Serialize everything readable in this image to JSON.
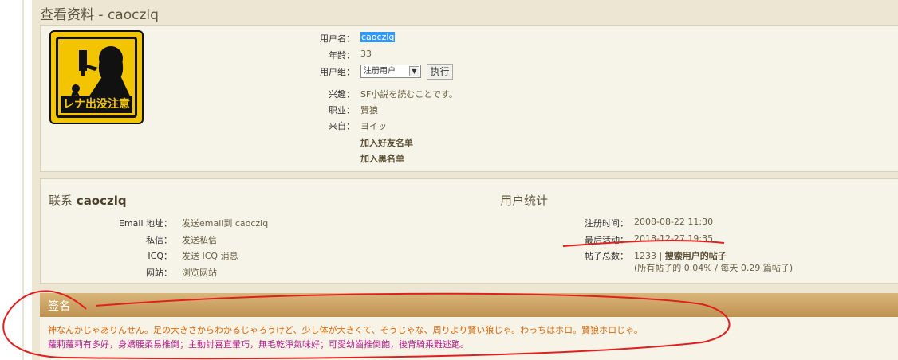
{
  "page": {
    "title": "查看资料 - caoczlq"
  },
  "avatar": {
    "text": "レナ出没注意"
  },
  "profile": {
    "username_label": "用户名：",
    "username": "caoczlq",
    "age_label": "年龄：",
    "age": "33",
    "group_label": "用户组：",
    "group_value": "注册用户",
    "exec_label": "执行",
    "interest_label": "兴趣：",
    "interest": "SF小説を読むことです。",
    "job_label": "职业：",
    "job": "賢狼",
    "from_label": "来自：",
    "from": "ヨイッ",
    "add_friend": "加入好友名单",
    "add_blacklist": "加入黑名单"
  },
  "contact": {
    "heading_prefix": "联系",
    "heading_name": "caoczlq",
    "email_label": "Email 地址：",
    "email_value": "发送email到 caoczlq",
    "pm_label": "私信：",
    "pm_value": "发送私信",
    "icq_label": "ICQ：",
    "icq_value": "发送 ICQ 消息",
    "web_label": "网站：",
    "web_value": "浏览网站"
  },
  "stats": {
    "heading": "用户统计",
    "reg_label": "注册时间：",
    "reg_value": "2008-08-22 11:30",
    "last_label": "最后活动：",
    "last_value": "2018-12-27 19:35",
    "posts_label": "帖子总数：",
    "posts_value": "1233",
    "posts_sep": "|",
    "search_posts": "搜索用户的帖子",
    "posts_detail": "(所有帖子的 0.04% / 每天 0.29 篇帖子)"
  },
  "signature": {
    "heading": "签名",
    "line1": "神なんかじゃありんせん。足の大きさからわかるじゃろうけど、少し体が大きくて、そうじゃな、周りより賢い狼じゃ。わっちはホロ。賢狼ホロじゃ。",
    "line2": "蘿莉蘿莉有多好，身嬌腰柔易推倒；主動討喜直暈巧，無毛乾淨氣味好；可愛幼齒推倒飽，後背騎乘難逃跑。"
  },
  "colors": {
    "panel": "#f6f3e8",
    "outer": "#ece6d3",
    "signature_bar": "#c99b5a",
    "annotation": "#e02020"
  }
}
